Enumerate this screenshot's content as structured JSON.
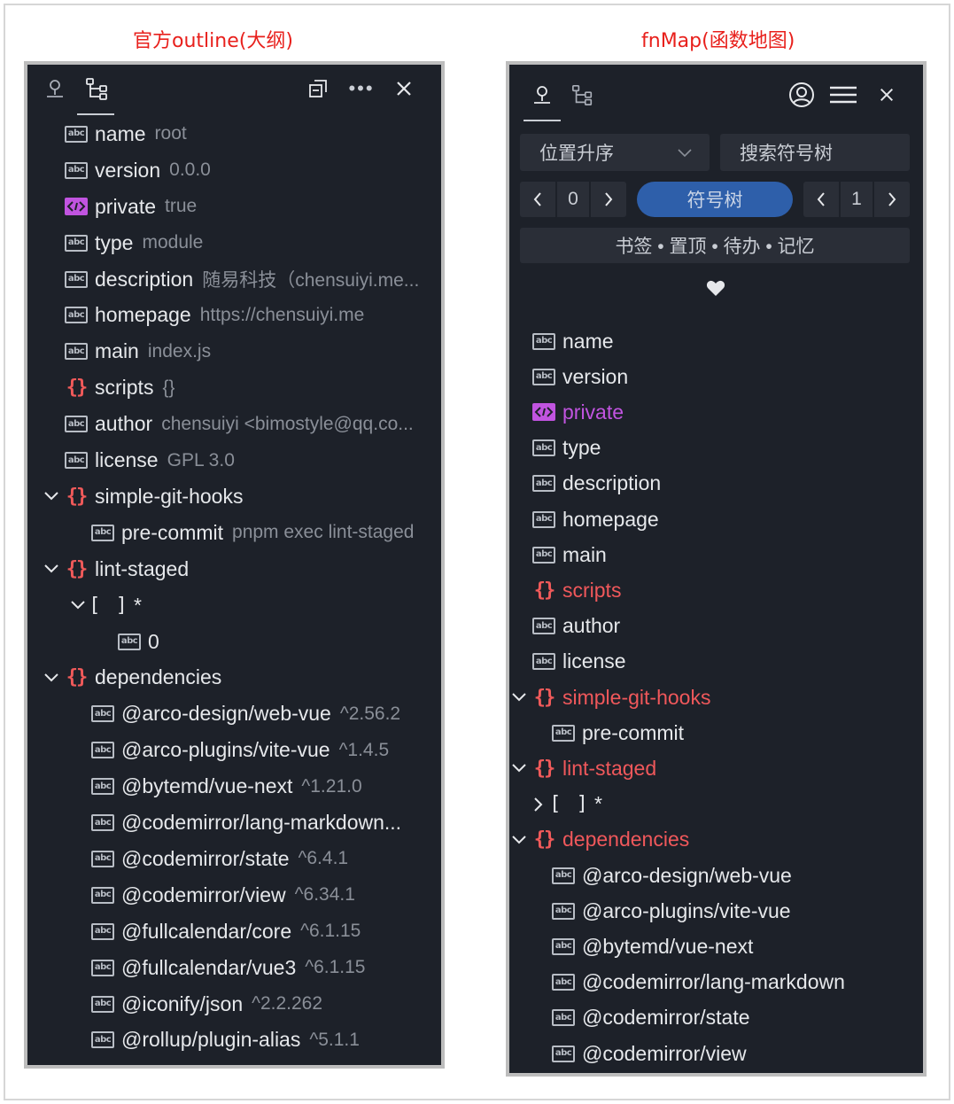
{
  "captions": {
    "left": "官方outline(大纲)",
    "right": "fnMap(函数地图)"
  },
  "outline": {
    "header_icons": [
      "outline-tab-icon",
      "tree-tab-icon",
      "collapse-all-icon",
      "more-icon",
      "close-icon"
    ],
    "items": [
      {
        "name": "name",
        "value": "root",
        "kind": "string",
        "depth": 0,
        "expander": "none"
      },
      {
        "name": "version",
        "value": "0.0.0",
        "kind": "string",
        "depth": 0,
        "expander": "none"
      },
      {
        "name": "private",
        "value": "true",
        "kind": "boolean",
        "depth": 0,
        "expander": "none"
      },
      {
        "name": "type",
        "value": "module",
        "kind": "string",
        "depth": 0,
        "expander": "none"
      },
      {
        "name": "description",
        "value": "随易科技（chensuiyi.me...",
        "kind": "string",
        "depth": 0,
        "expander": "none"
      },
      {
        "name": "homepage",
        "value": "https://chensuiyi.me",
        "kind": "string",
        "depth": 0,
        "expander": "none"
      },
      {
        "name": "main",
        "value": "index.js",
        "kind": "string",
        "depth": 0,
        "expander": "none"
      },
      {
        "name": "scripts",
        "value": "{}",
        "kind": "object",
        "depth": 0,
        "expander": "none"
      },
      {
        "name": "author",
        "value": "chensuiyi <bimostyle@qq.co...",
        "kind": "string",
        "depth": 0,
        "expander": "none"
      },
      {
        "name": "license",
        "value": "GPL 3.0",
        "kind": "string",
        "depth": 0,
        "expander": "none"
      },
      {
        "name": "simple-git-hooks",
        "value": "",
        "kind": "object",
        "depth": 0,
        "expander": "open"
      },
      {
        "name": "pre-commit",
        "value": "pnpm exec lint-staged",
        "kind": "string",
        "depth": 1,
        "expander": "none"
      },
      {
        "name": "lint-staged",
        "value": "",
        "kind": "object",
        "depth": 0,
        "expander": "open"
      },
      {
        "name": "*",
        "value": "",
        "kind": "array",
        "depth": 1,
        "expander": "open"
      },
      {
        "name": "0",
        "value": "",
        "kind": "string",
        "depth": 2,
        "expander": "none"
      },
      {
        "name": "dependencies",
        "value": "",
        "kind": "object",
        "depth": 0,
        "expander": "open"
      },
      {
        "name": "@arco-design/web-vue",
        "value": "^2.56.2",
        "kind": "string",
        "depth": 1,
        "expander": "none"
      },
      {
        "name": "@arco-plugins/vite-vue",
        "value": "^1.4.5",
        "kind": "string",
        "depth": 1,
        "expander": "none"
      },
      {
        "name": "@bytemd/vue-next",
        "value": "^1.21.0",
        "kind": "string",
        "depth": 1,
        "expander": "none"
      },
      {
        "name": "@codemirror/lang-markdown...",
        "value": "",
        "kind": "string",
        "depth": 1,
        "expander": "none"
      },
      {
        "name": "@codemirror/state",
        "value": "^6.4.1",
        "kind": "string",
        "depth": 1,
        "expander": "none"
      },
      {
        "name": "@codemirror/view",
        "value": "^6.34.1",
        "kind": "string",
        "depth": 1,
        "expander": "none"
      },
      {
        "name": "@fullcalendar/core",
        "value": "^6.1.15",
        "kind": "string",
        "depth": 1,
        "expander": "none"
      },
      {
        "name": "@fullcalendar/vue3",
        "value": "^6.1.15",
        "kind": "string",
        "depth": 1,
        "expander": "none"
      },
      {
        "name": "@iconify/json",
        "value": "^2.2.262",
        "kind": "string",
        "depth": 1,
        "expander": "none"
      },
      {
        "name": "@rollup/plugin-alias",
        "value": "^5.1.1",
        "kind": "string",
        "depth": 1,
        "expander": "none"
      }
    ]
  },
  "fnmap": {
    "header_icons": [
      "outline-tab-icon",
      "tree-tab-icon",
      "user-icon",
      "menu-icon",
      "close-icon"
    ],
    "sort_select": "位置升序",
    "search_placeholder": "搜索符号树",
    "pager_left": "0",
    "symbol_tree_button": "符号树",
    "pager_right": "1",
    "bookmark_bar": "书签 • 置顶 • 待办 • 记忆",
    "items": [
      {
        "name": "name",
        "kind": "string",
        "depth": 0,
        "expander": "none"
      },
      {
        "name": "version",
        "kind": "string",
        "depth": 0,
        "expander": "none"
      },
      {
        "name": "private",
        "kind": "boolean",
        "depth": 0,
        "expander": "none"
      },
      {
        "name": "type",
        "kind": "string",
        "depth": 0,
        "expander": "none"
      },
      {
        "name": "description",
        "kind": "string",
        "depth": 0,
        "expander": "none"
      },
      {
        "name": "homepage",
        "kind": "string",
        "depth": 0,
        "expander": "none"
      },
      {
        "name": "main",
        "kind": "string",
        "depth": 0,
        "expander": "none"
      },
      {
        "name": "scripts",
        "kind": "object",
        "depth": 0,
        "expander": "none"
      },
      {
        "name": "author",
        "kind": "string",
        "depth": 0,
        "expander": "none"
      },
      {
        "name": "license",
        "kind": "string",
        "depth": 0,
        "expander": "none"
      },
      {
        "name": "simple-git-hooks",
        "kind": "object",
        "depth": 0,
        "expander": "open"
      },
      {
        "name": "pre-commit",
        "kind": "string",
        "depth": 1,
        "expander": "none"
      },
      {
        "name": "lint-staged",
        "kind": "object",
        "depth": 0,
        "expander": "open"
      },
      {
        "name": "*",
        "kind": "array",
        "depth": 1,
        "expander": "closed"
      },
      {
        "name": "dependencies",
        "kind": "object",
        "depth": 0,
        "expander": "open"
      },
      {
        "name": "@arco-design/web-vue",
        "kind": "string",
        "depth": 1,
        "expander": "none"
      },
      {
        "name": "@arco-plugins/vite-vue",
        "kind": "string",
        "depth": 1,
        "expander": "none"
      },
      {
        "name": "@bytemd/vue-next",
        "kind": "string",
        "depth": 1,
        "expander": "none"
      },
      {
        "name": "@codemirror/lang-markdown",
        "kind": "string",
        "depth": 1,
        "expander": "none"
      },
      {
        "name": "@codemirror/state",
        "kind": "string",
        "depth": 1,
        "expander": "none"
      },
      {
        "name": "@codemirror/view",
        "kind": "string",
        "depth": 1,
        "expander": "none"
      }
    ]
  },
  "colors": {
    "panel_bg": "#1d2129",
    "caption": "#e8201c",
    "object_red": "#f05a5a",
    "boolean_purple": "#c154e0",
    "primary_blue": "#2e5faa"
  }
}
